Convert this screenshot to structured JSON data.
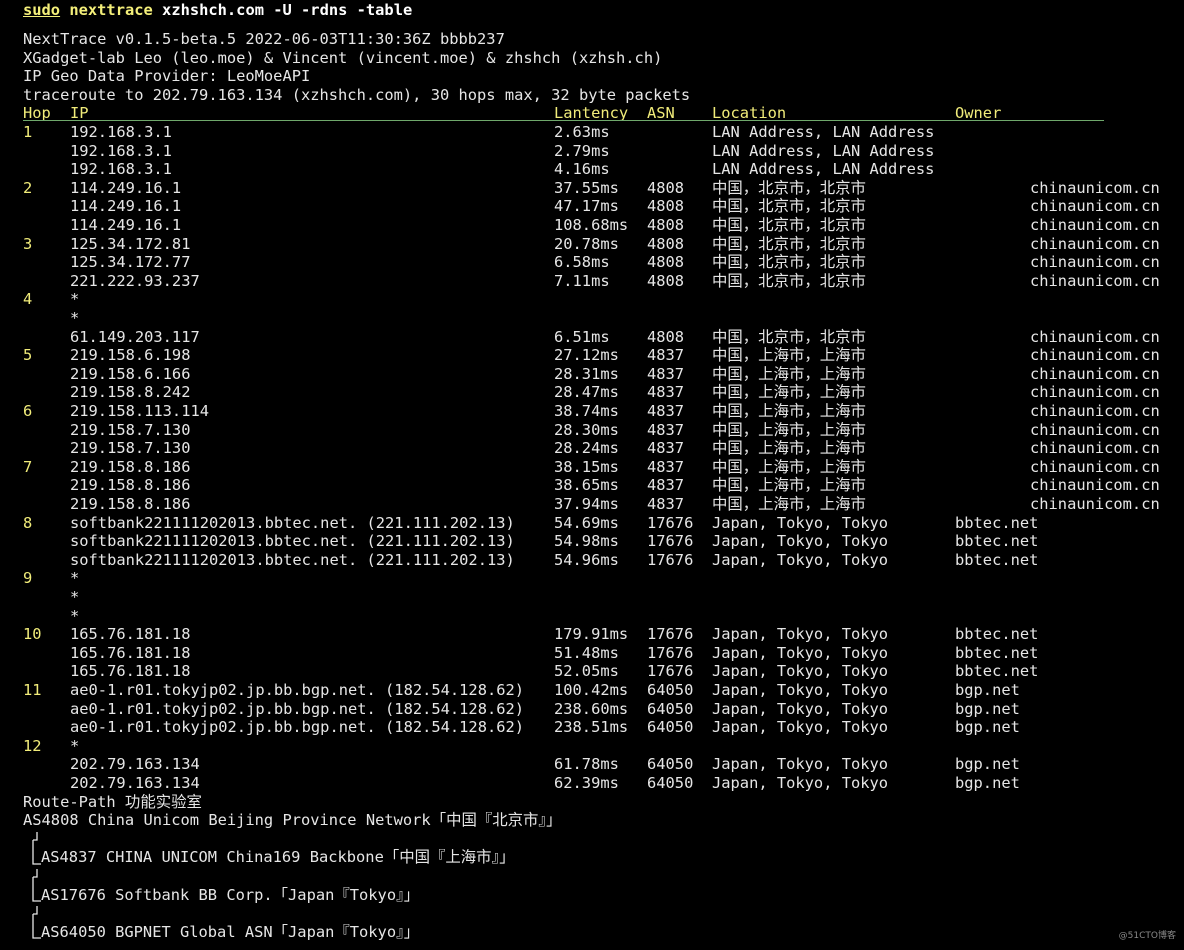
{
  "command": {
    "sudo": "sudo",
    "program": "nexttrace",
    "args": "xzhshch.com -U -rdns -table"
  },
  "info": [
    "NextTrace v0.1.5-beta.5 2022-06-03T11:30:36Z bbbb237",
    "XGadget-lab Leo (leo.moe) & Vincent (vincent.moe) & zhshch (xzhsh.ch)",
    "IP Geo Data Provider: LeoMoeAPI",
    "traceroute to 202.79.163.134 (xzhshch.com), 30 hops max, 32 byte packets"
  ],
  "table_header": {
    "hop": "Hop",
    "ip": "IP",
    "latency": "Lantency",
    "asn": "ASN",
    "location": "Location",
    "owner": "Owner"
  },
  "rows": [
    {
      "hop": "1",
      "ip": "192.168.3.1",
      "latency": "2.63ms",
      "asn": "",
      "location": "LAN Address, LAN Address",
      "owner": ""
    },
    {
      "hop": "",
      "ip": "192.168.3.1",
      "latency": "2.79ms",
      "asn": "",
      "location": "LAN Address, LAN Address",
      "owner": ""
    },
    {
      "hop": "",
      "ip": "192.168.3.1",
      "latency": "4.16ms",
      "asn": "",
      "location": "LAN Address, LAN Address",
      "owner": ""
    },
    {
      "hop": "2",
      "ip": "114.249.16.1",
      "latency": "37.55ms",
      "asn": "4808",
      "location": "中国，北京市，北京市",
      "owner": "chinaunicom.cn"
    },
    {
      "hop": "",
      "ip": "114.249.16.1",
      "latency": "47.17ms",
      "asn": "4808",
      "location": "中国，北京市，北京市",
      "owner": "chinaunicom.cn"
    },
    {
      "hop": "",
      "ip": "114.249.16.1",
      "latency": "108.68ms",
      "asn": "4808",
      "location": "中国，北京市，北京市",
      "owner": "chinaunicom.cn"
    },
    {
      "hop": "3",
      "ip": "125.34.172.81",
      "latency": "20.78ms",
      "asn": "4808",
      "location": "中国，北京市，北京市",
      "owner": "chinaunicom.cn"
    },
    {
      "hop": "",
      "ip": "125.34.172.77",
      "latency": "6.58ms",
      "asn": "4808",
      "location": "中国，北京市，北京市",
      "owner": "chinaunicom.cn"
    },
    {
      "hop": "",
      "ip": "221.222.93.237",
      "latency": "7.11ms",
      "asn": "4808",
      "location": "中国，北京市，北京市",
      "owner": "chinaunicom.cn"
    },
    {
      "hop": "4",
      "ip": "*",
      "latency": "",
      "asn": "",
      "location": "",
      "owner": ""
    },
    {
      "hop": "",
      "ip": "*",
      "latency": "",
      "asn": "",
      "location": "",
      "owner": ""
    },
    {
      "hop": "",
      "ip": "61.149.203.117",
      "latency": "6.51ms",
      "asn": "4808",
      "location": "中国，北京市，北京市",
      "owner": "chinaunicom.cn"
    },
    {
      "hop": "5",
      "ip": "219.158.6.198",
      "latency": "27.12ms",
      "asn": "4837",
      "location": "中国，上海市，上海市",
      "owner": "chinaunicom.cn"
    },
    {
      "hop": "",
      "ip": "219.158.6.166",
      "latency": "28.31ms",
      "asn": "4837",
      "location": "中国，上海市，上海市",
      "owner": "chinaunicom.cn"
    },
    {
      "hop": "",
      "ip": "219.158.8.242",
      "latency": "28.47ms",
      "asn": "4837",
      "location": "中国，上海市，上海市",
      "owner": "chinaunicom.cn"
    },
    {
      "hop": "6",
      "ip": "219.158.113.114",
      "latency": "38.74ms",
      "asn": "4837",
      "location": "中国，上海市，上海市",
      "owner": "chinaunicom.cn"
    },
    {
      "hop": "",
      "ip": "219.158.7.130",
      "latency": "28.30ms",
      "asn": "4837",
      "location": "中国，上海市，上海市",
      "owner": "chinaunicom.cn"
    },
    {
      "hop": "",
      "ip": "219.158.7.130",
      "latency": "28.24ms",
      "asn": "4837",
      "location": "中国，上海市，上海市",
      "owner": "chinaunicom.cn"
    },
    {
      "hop": "7",
      "ip": "219.158.8.186",
      "latency": "38.15ms",
      "asn": "4837",
      "location": "中国，上海市，上海市",
      "owner": "chinaunicom.cn"
    },
    {
      "hop": "",
      "ip": "219.158.8.186",
      "latency": "38.65ms",
      "asn": "4837",
      "location": "中国，上海市，上海市",
      "owner": "chinaunicom.cn"
    },
    {
      "hop": "",
      "ip": "219.158.8.186",
      "latency": "37.94ms",
      "asn": "4837",
      "location": "中国，上海市，上海市",
      "owner": "chinaunicom.cn"
    },
    {
      "hop": "8",
      "ip": "softbank221111202013.bbtec.net. (221.111.202.13)",
      "latency": "54.69ms",
      "asn": "17676",
      "location": "Japan, Tokyo, Tokyo",
      "owner": "bbtec.net"
    },
    {
      "hop": "",
      "ip": "softbank221111202013.bbtec.net. (221.111.202.13)",
      "latency": "54.98ms",
      "asn": "17676",
      "location": "Japan, Tokyo, Tokyo",
      "owner": "bbtec.net"
    },
    {
      "hop": "",
      "ip": "softbank221111202013.bbtec.net. (221.111.202.13)",
      "latency": "54.96ms",
      "asn": "17676",
      "location": "Japan, Tokyo, Tokyo",
      "owner": "bbtec.net"
    },
    {
      "hop": "9",
      "ip": "*",
      "latency": "",
      "asn": "",
      "location": "",
      "owner": ""
    },
    {
      "hop": "",
      "ip": "*",
      "latency": "",
      "asn": "",
      "location": "",
      "owner": ""
    },
    {
      "hop": "",
      "ip": "*",
      "latency": "",
      "asn": "",
      "location": "",
      "owner": ""
    },
    {
      "hop": "10",
      "ip": "165.76.181.18",
      "latency": "179.91ms",
      "asn": "17676",
      "location": "Japan, Tokyo, Tokyo",
      "owner": "bbtec.net"
    },
    {
      "hop": "",
      "ip": "165.76.181.18",
      "latency": "51.48ms",
      "asn": "17676",
      "location": "Japan, Tokyo, Tokyo",
      "owner": "bbtec.net"
    },
    {
      "hop": "",
      "ip": "165.76.181.18",
      "latency": "52.05ms",
      "asn": "17676",
      "location": "Japan, Tokyo, Tokyo",
      "owner": "bbtec.net"
    },
    {
      "hop": "11",
      "ip": "ae0-1.r01.tokyjp02.jp.bb.bgp.net. (182.54.128.62)",
      "latency": "100.42ms",
      "asn": "64050",
      "location": "Japan, Tokyo, Tokyo",
      "owner": "bgp.net"
    },
    {
      "hop": "",
      "ip": "ae0-1.r01.tokyjp02.jp.bb.bgp.net. (182.54.128.62)",
      "latency": "238.60ms",
      "asn": "64050",
      "location": "Japan, Tokyo, Tokyo",
      "owner": "bgp.net"
    },
    {
      "hop": "",
      "ip": "ae0-1.r01.tokyjp02.jp.bb.bgp.net. (182.54.128.62)",
      "latency": "238.51ms",
      "asn": "64050",
      "location": "Japan, Tokyo, Tokyo",
      "owner": "bgp.net"
    },
    {
      "hop": "12",
      "ip": "*",
      "latency": "",
      "asn": "",
      "location": "",
      "owner": ""
    },
    {
      "hop": "",
      "ip": "202.79.163.134",
      "latency": "61.78ms",
      "asn": "64050",
      "location": "Japan, Tokyo, Tokyo",
      "owner": "bgp.net"
    },
    {
      "hop": "",
      "ip": "202.79.163.134",
      "latency": "62.39ms",
      "asn": "64050",
      "location": "Japan, Tokyo, Tokyo",
      "owner": "bgp.net"
    }
  ],
  "route_path": {
    "title": "Route-Path 功能实验室",
    "first": "AS4808 China Unicom Beijing Province Network「中国『北京市』」",
    "entries": [
      "AS4837 CHINA UNICOM China169 Backbone「中国『上海市』」",
      "AS17676 Softbank BB Corp.「Japan『Tokyo』」",
      "AS64050 BGPNET Global ASN「Japan『Tokyo』」"
    ]
  },
  "watermark": "@51CTO博客",
  "colors": {
    "background": "#000000",
    "text": "#e6e6e6",
    "accent_yellow": "#f1ec7a",
    "rule_green": "#6fa86b"
  }
}
